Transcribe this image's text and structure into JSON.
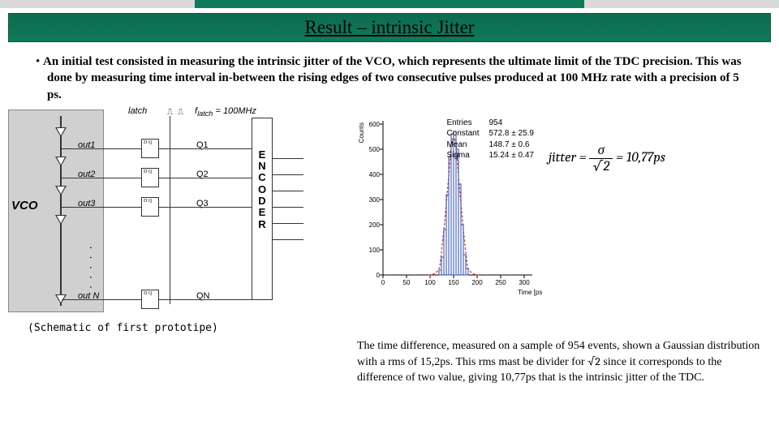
{
  "title": "Result – intrinsic Jitter",
  "bullet": "An initial test consisted in measuring the intrinsic jitter of the VCO, which represents the ultimate limit of the TDC precision. This was done by measuring time interval in-between the rising edges of two consecutive pulses produced at 100 MHz rate with a precision of 5 ps.",
  "schematic": {
    "vco_label": "VCO",
    "latch_label": "latch",
    "freq_label": "f_latch = 100MHz",
    "outs": [
      "out1",
      "out2",
      "out3",
      "out N"
    ],
    "qs": [
      "Q1",
      "Q2",
      "Q3",
      "QN"
    ],
    "encoder": "ENCODER"
  },
  "caption": "(Schematic of first prototipe)",
  "chart_data": {
    "type": "histogram",
    "xlabel": "Time [ps]",
    "ylabel": "Counts",
    "xticks": [
      0,
      50,
      100,
      150,
      200,
      250,
      300
    ],
    "yticks": [
      0,
      100,
      200,
      300,
      400,
      500,
      600
    ],
    "xlim": [
      -10,
      320
    ],
    "ylim": [
      0,
      620
    ],
    "fit_curve": "gaussian",
    "stats": {
      "Entries": "954",
      "Constant": "572.8 ± 25.9",
      "Mean": "148.7 ± 0.6",
      "Sigma": "15.24 ± 0.47"
    },
    "bins": [
      {
        "x": 120,
        "y": 20
      },
      {
        "x": 125,
        "y": 70
      },
      {
        "x": 130,
        "y": 180
      },
      {
        "x": 135,
        "y": 320
      },
      {
        "x": 140,
        "y": 470
      },
      {
        "x": 145,
        "y": 560
      },
      {
        "x": 150,
        "y": 570
      },
      {
        "x": 155,
        "y": 500
      },
      {
        "x": 160,
        "y": 360
      },
      {
        "x": 165,
        "y": 200
      },
      {
        "x": 170,
        "y": 80
      },
      {
        "x": 175,
        "y": 25
      }
    ]
  },
  "formula": {
    "lhs": "jitter",
    "numerator": "σ",
    "denominator": "√2",
    "rhs": "10,77ps"
  },
  "bottom_text_1": "The time difference, measured on a sample of 954 events, shown a Gaussian distribution with a rms of 15,2ps. This rms mast be   divider for",
  "bottom_text_2": " since it corresponds to the difference of two value, giving   10,77ps that is the intrinsic jitter of the TDC.",
  "sqrt2": "√2"
}
